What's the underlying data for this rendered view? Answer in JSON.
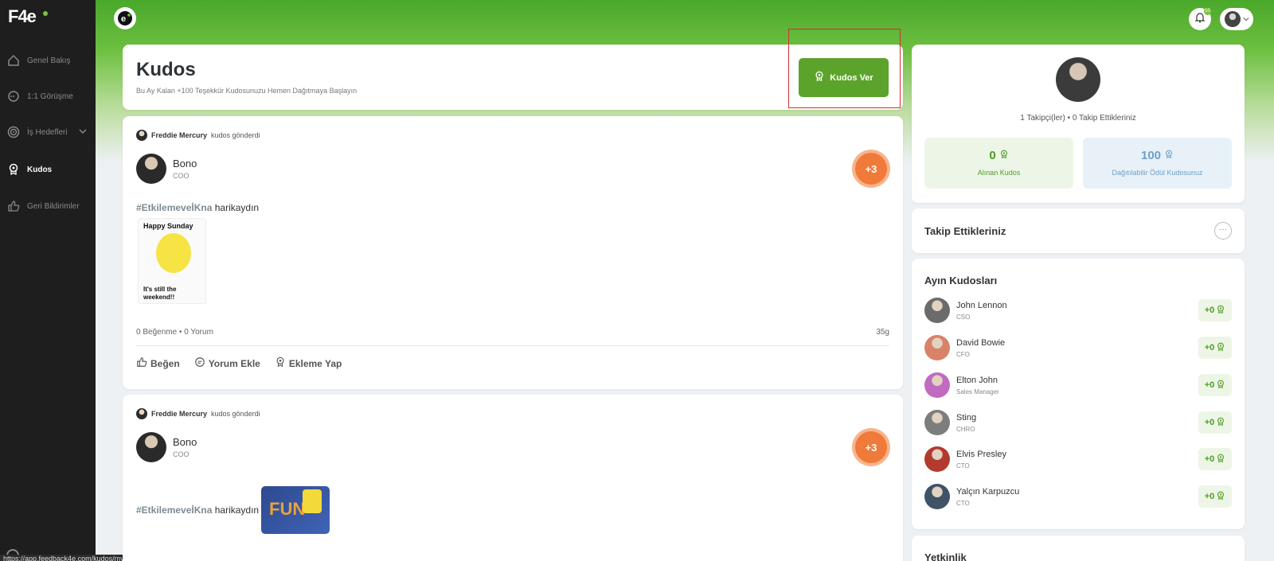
{
  "sidebar": {
    "logo": "F4e",
    "items": [
      {
        "label": "Genel Bakış",
        "icon": "home-icon"
      },
      {
        "label": "1:1 Görüşme",
        "icon": "chat-icon"
      },
      {
        "label": "İş Hedefleri",
        "icon": "target-icon"
      },
      {
        "label": "Kudos",
        "icon": "kudos-icon"
      },
      {
        "label": "Geri Bildirimler",
        "icon": "thumb-up-icon"
      }
    ]
  },
  "topbar": {
    "notification_count": "10"
  },
  "header": {
    "title": "Kudos",
    "subtitle": "Bu Ay Kalan +100 Teşekkür Kudosunuzu Hemen Dağıtmaya Başlayın",
    "give_button": "Kudos Ver"
  },
  "posts": [
    {
      "sender": "Freddie Mercury",
      "action": "kudos gönderdi",
      "recipient": "Bono",
      "role": "COO",
      "points": "+3",
      "tag": "#EtkilemeveİKna",
      "message": "harikaydın",
      "gif_top": "Happy Sunday",
      "gif_bottom": "It's still the weekend!!",
      "stats": "0 Beğenme • 0 Yorum",
      "time": "35g",
      "actions": [
        "Beğen",
        "Yorum Ekle",
        "Ekleme Yap"
      ]
    },
    {
      "sender": "Freddie Mercury",
      "action": "kudos gönderdi",
      "recipient": "Bono",
      "role": "COO",
      "points": "+3",
      "tag": "#EtkilemeveİKna",
      "message": "harikaydın",
      "gif_text": "FUN"
    }
  ],
  "profile": {
    "follow_text": "1 Takipçi(ler) • 0 Takip Ettikleriniz",
    "received": {
      "value": "0",
      "label": "Alınan Kudos"
    },
    "distributable": {
      "value": "100",
      "label": "Dağıtılabilir Ödül Kudosunuz"
    }
  },
  "following": {
    "title": "Takip Ettikleriniz",
    "more": "···"
  },
  "month": {
    "title": "Ayın Kudosları",
    "rows": [
      {
        "name": "John Lennon",
        "role": "CSO",
        "points": "+0",
        "color": "#6b6b6b"
      },
      {
        "name": "David Bowie",
        "role": "CFO",
        "points": "+0",
        "color": "#d9826a"
      },
      {
        "name": "Elton John",
        "role": "Sales Manager",
        "points": "+0",
        "color": "#c06bbf"
      },
      {
        "name": "Sting",
        "role": "CHRO",
        "points": "+0",
        "color": "#7d7d7d"
      },
      {
        "name": "Elvis Presley",
        "role": "CTO",
        "points": "+0",
        "color": "#b33a2e"
      },
      {
        "name": "Yalçın Karpuzcu",
        "role": "CTO",
        "points": "+0",
        "color": "#3f5266"
      }
    ]
  },
  "skills": {
    "title": "Yetkinlik"
  },
  "statusbar": {
    "url": "https://app.feedback4e.com/kudos/my-kudos"
  },
  "colors": {
    "accent": "#5ca32c",
    "points_badge": "#f07a3a",
    "sidebar": "#1e1e1e"
  }
}
